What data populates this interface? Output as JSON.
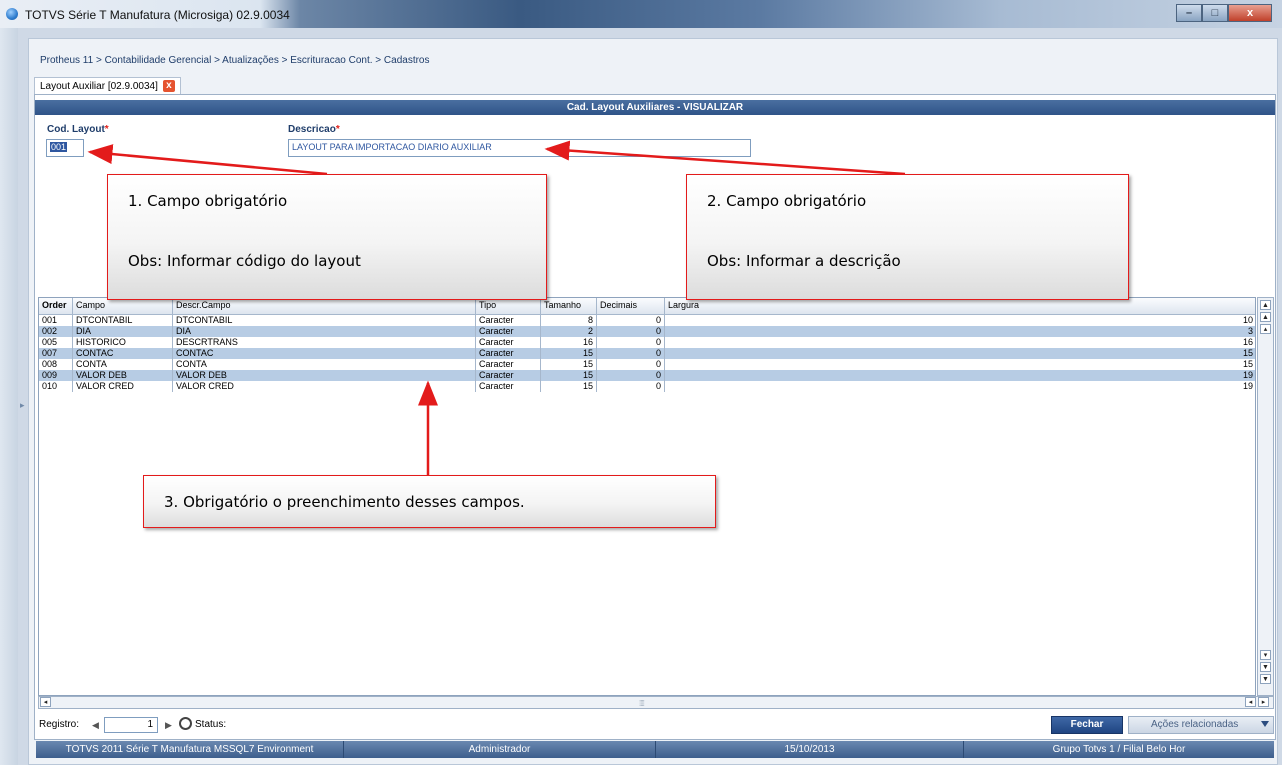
{
  "window": {
    "title": "TOTVS Série T Manufatura (Microsiga) 02.9.0034",
    "min_label": "–",
    "max_label": "□",
    "close_label": "x"
  },
  "breadcrumb": "Protheus 11 > Contabilidade Gerencial > Atualizações > Escrituracao Cont. > Cadastros",
  "tab": {
    "label": "Layout Auxiliar [02.9.0034]",
    "close": "x"
  },
  "panel": {
    "title": "Cad. Layout Auxiliares - VISUALIZAR"
  },
  "form": {
    "cod_label": "Cod. Layout",
    "cod_value": "001",
    "desc_label": "Descricao",
    "desc_value": "LAYOUT PARA IMPORTACAO DIARIO AUXILIAR",
    "required_mark": "*"
  },
  "grid": {
    "columns": [
      "Order",
      "Campo",
      "Descr.Campo",
      "Tipo",
      "Tamanho",
      "Decimais",
      "Largura"
    ],
    "rows": [
      [
        "001",
        "DTCONTABIL",
        "DTCONTABIL",
        "Caracter",
        "8",
        "0",
        "10"
      ],
      [
        "002",
        "DIA",
        "DIA",
        "Caracter",
        "2",
        "0",
        "3"
      ],
      [
        "005",
        "HISTORICO",
        "DESCRTRANS",
        "Caracter",
        "16",
        "0",
        "16"
      ],
      [
        "007",
        "CONTAC",
        "CONTAC",
        "Caracter",
        "15",
        "0",
        "15"
      ],
      [
        "008",
        "CONTA",
        "CONTA",
        "Caracter",
        "15",
        "0",
        "15"
      ],
      [
        "009",
        "VALOR DEB",
        "VALOR DEB",
        "Caracter",
        "15",
        "0",
        "19"
      ],
      [
        "010",
        "VALOR CRED",
        "VALOR CRED",
        "Caracter",
        "15",
        "0",
        "19"
      ]
    ]
  },
  "footer": {
    "registro_label": "Registro:",
    "registro_value": "1",
    "status_label": "Status:",
    "fechar": "Fechar",
    "acoes": "Ações relacionadas"
  },
  "statusbar": {
    "environment": "TOTVS 2011 Série T Manufatura MSSQL7 Environment",
    "user": "Administrador",
    "date": "15/10/2013",
    "branch": "Grupo Totvs 1 / Filial Belo Hor"
  },
  "callouts": {
    "c1_line1": "1. Campo obrigatório",
    "c1_line2": "Obs: Informar código do layout",
    "c2_line1": "2. Campo obrigatório",
    "c2_line2": "Obs: Informar a descrição",
    "c3_line1": "3. Obrigatório o preenchimento desses campos."
  },
  "colors": {
    "accent": "#2f5388",
    "row_alt": "#b7cce4",
    "callout_border": "#e31b1b"
  }
}
